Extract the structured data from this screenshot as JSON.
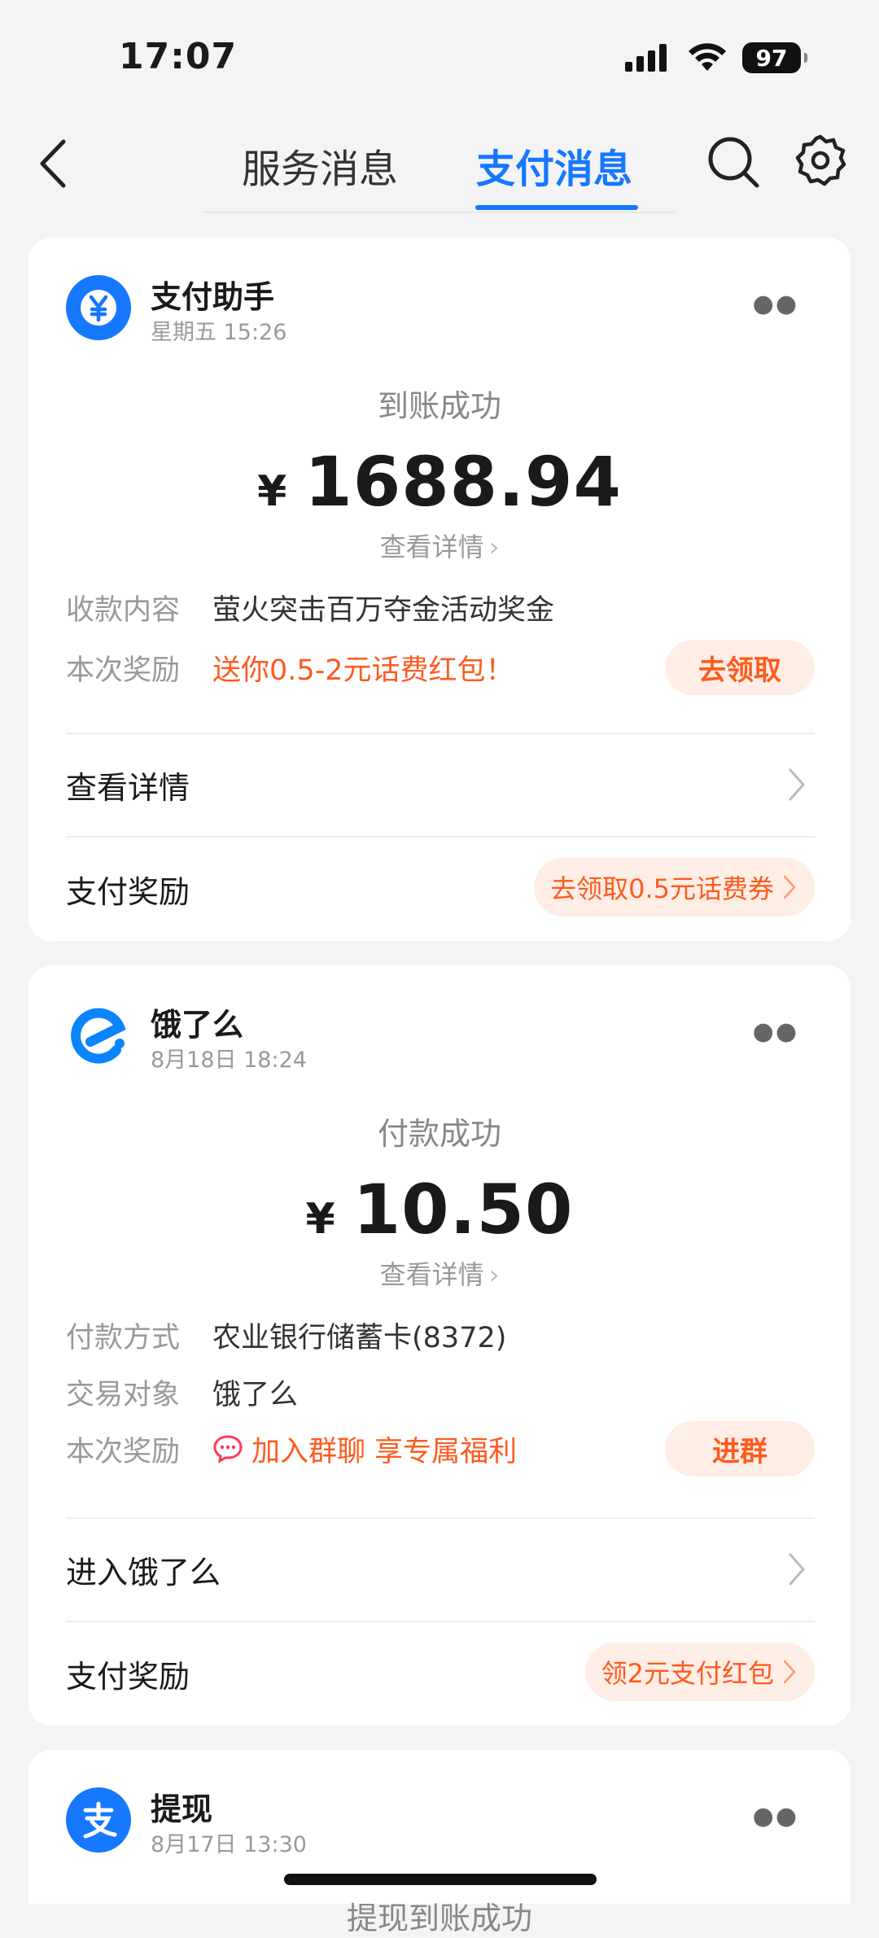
{
  "status_bar": {
    "time": "17:07",
    "battery": "97"
  },
  "nav": {
    "tab_service": "服务消息",
    "tab_pay": "支付消息"
  },
  "cards": [
    {
      "name": "支付助手",
      "time": "星期五 15:26",
      "status": "到账成功",
      "currency": "¥",
      "amount": "1688.94",
      "detail_link": "查看详情",
      "rows": [
        {
          "label": "收款内容",
          "value": "萤火突击百万夺金活动奖金"
        },
        {
          "label": "本次奖励",
          "value": "送你0.5-2元话费红包！",
          "button": "去领取"
        }
      ],
      "link_label": "查看详情",
      "reward_label": "支付奖励",
      "reward_pill": "去领取0.5元话费券"
    },
    {
      "name": "饿了么",
      "time": "8月18日 18:24",
      "status": "付款成功",
      "currency": "¥",
      "amount": "10.50",
      "detail_link": "查看详情",
      "rows": [
        {
          "label": "付款方式",
          "value": "农业银行储蓄卡(8372)"
        },
        {
          "label": "交易对象",
          "value": "饿了么"
        },
        {
          "label": "本次奖励",
          "value": "加入群聊 享专属福利",
          "button": "进群"
        }
      ],
      "link_label": "进入饿了么",
      "reward_label": "支付奖励",
      "reward_pill": "领2元支付红包"
    },
    {
      "name": "提现",
      "time": "8月17日 13:30",
      "status": "提现到账成功"
    }
  ],
  "colors": {
    "accent": "#1677ff",
    "orange": "#ff5a1f",
    "pill_bg": "#ffeee6",
    "bg": "#f4f4f6"
  }
}
